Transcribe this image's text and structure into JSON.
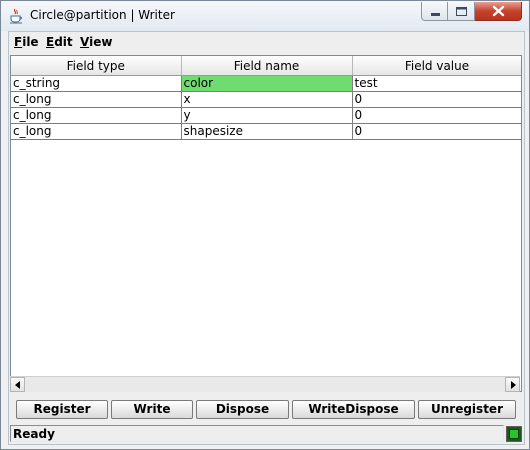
{
  "window": {
    "title": "Circle@partition | Writer",
    "icon": "java-cup-icon",
    "controls": [
      "minimize-icon",
      "maximize-icon",
      "close-icon"
    ]
  },
  "menu": {
    "items": [
      {
        "label": "File",
        "mnemonic": "F",
        "rest": "ile"
      },
      {
        "label": "Edit",
        "mnemonic": "E",
        "rest": "dit"
      },
      {
        "label": "View",
        "mnemonic": "V",
        "rest": "iew"
      }
    ]
  },
  "table": {
    "columns": [
      "Field type",
      "Field name",
      "Field value"
    ],
    "rows": [
      {
        "type": "c_string",
        "name": "color",
        "value": "test",
        "selected": true
      },
      {
        "type": "c_long",
        "name": "x",
        "value": "0",
        "selected": false
      },
      {
        "type": "c_long",
        "name": "y",
        "value": "0",
        "selected": false
      },
      {
        "type": "c_long",
        "name": "shapesize",
        "value": "0",
        "selected": false
      }
    ],
    "selection_color": "#6fdc6f"
  },
  "buttons": {
    "register": "Register",
    "write": "Write",
    "dispose": "Dispose",
    "write_dispose": "WriteDispose",
    "unregister": "Unregister"
  },
  "status": {
    "text": "Ready",
    "indicator_color": "#2fbf2f"
  }
}
